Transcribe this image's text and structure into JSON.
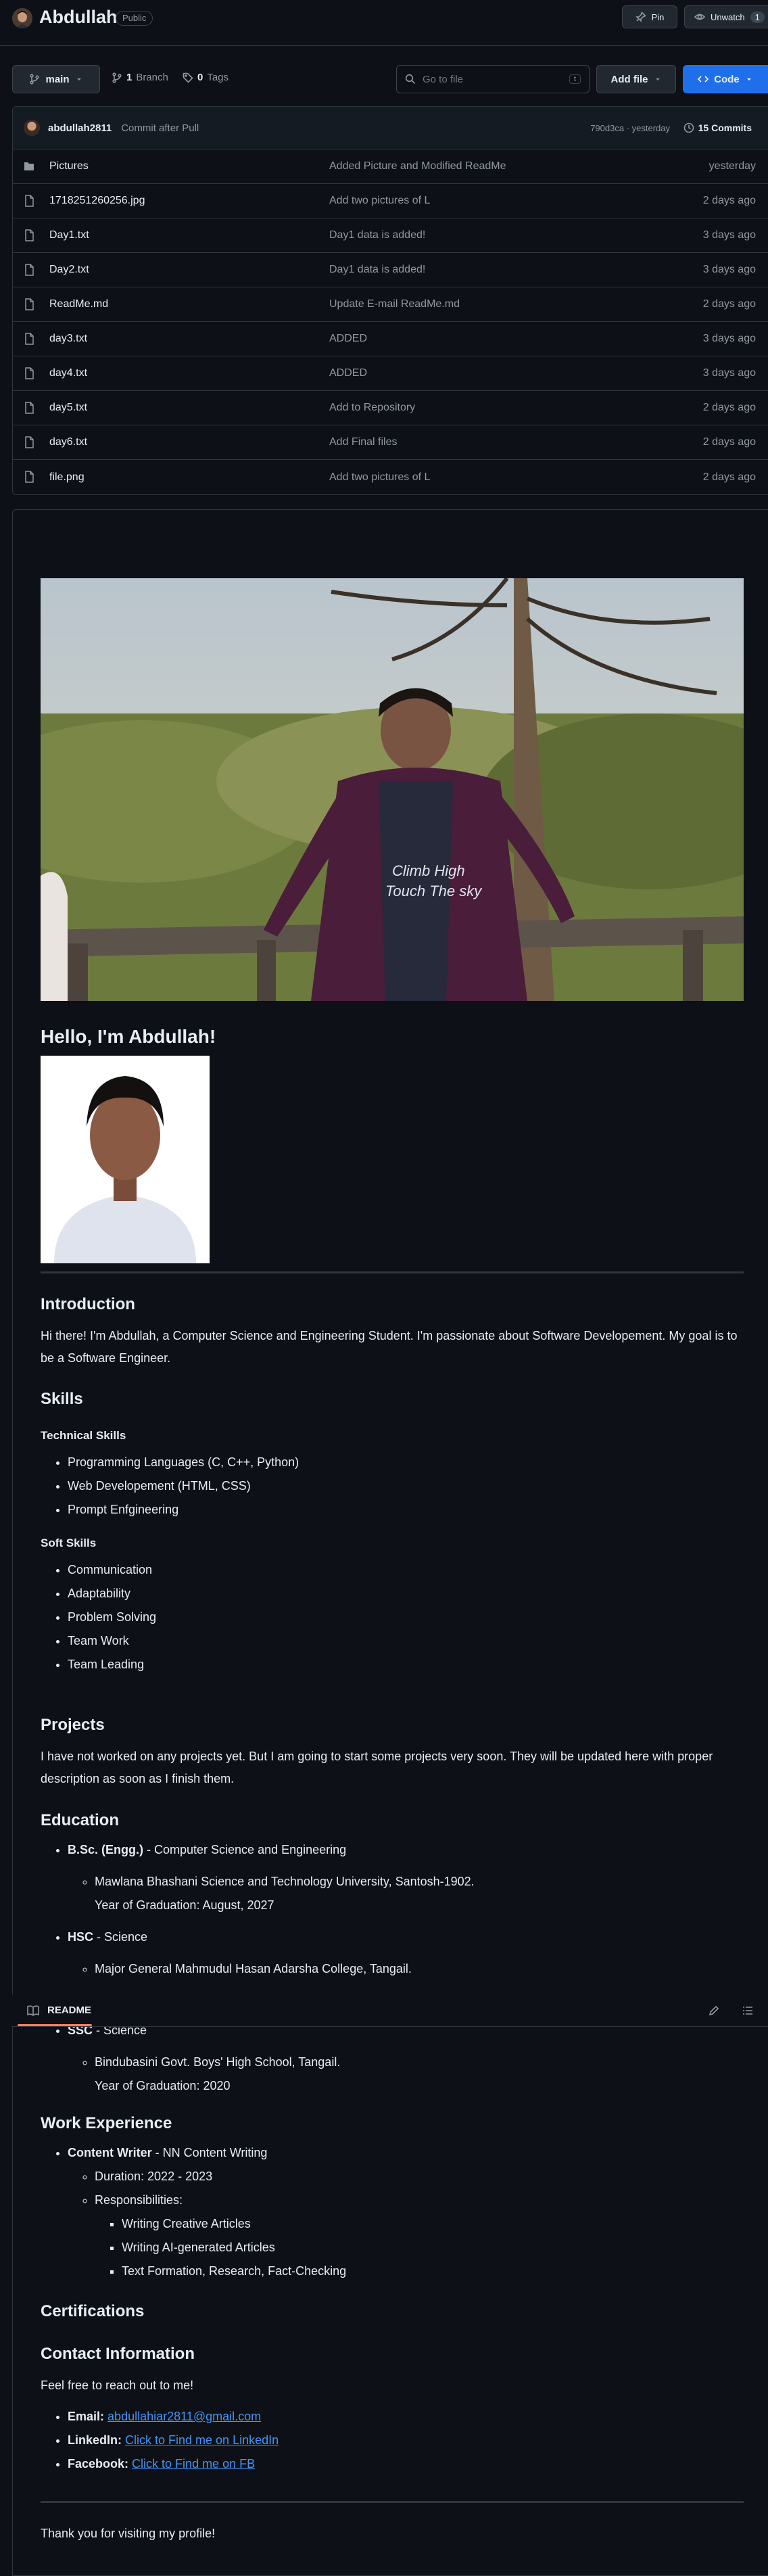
{
  "header": {
    "repo_name": "Abdullah",
    "visibility": "Public",
    "pin_label": "Pin",
    "unwatch_label": "Unwatch",
    "watch_count": "1"
  },
  "toolbar": {
    "branch": "main",
    "branches_count": "1",
    "branches_label": "Branch",
    "tags_count": "0",
    "tags_label": "Tags",
    "search_placeholder": "Go to file",
    "search_shortcut": "t",
    "add_file_label": "Add file",
    "code_label": "Code"
  },
  "commit": {
    "user": "abdullah2811",
    "message": "Commit after Pull",
    "sha_time": "790d3ca · yesterday",
    "commits_label": "15 Commits"
  },
  "files": [
    {
      "name": "Pictures",
      "type": "folder",
      "message": "Added Picture and Modified ReadMe",
      "date": "yesterday"
    },
    {
      "name": "1718251260256.jpg",
      "type": "file",
      "message": "Add two pictures of L",
      "date": "2 days ago"
    },
    {
      "name": "Day1.txt",
      "type": "file",
      "message": "Day1 data is added!",
      "date": "3 days ago"
    },
    {
      "name": "Day2.txt",
      "type": "file",
      "message": "Day1 data is added!",
      "date": "3 days ago"
    },
    {
      "name": "ReadMe.md",
      "type": "file",
      "message": "Update E-mail ReadMe.md",
      "date": "2 days ago"
    },
    {
      "name": "day3.txt",
      "type": "file",
      "message": "ADDED",
      "date": "3 days ago"
    },
    {
      "name": "day4.txt",
      "type": "file",
      "message": "ADDED",
      "date": "3 days ago"
    },
    {
      "name": "day5.txt",
      "type": "file",
      "message": "Add to Repository",
      "date": "2 days ago"
    },
    {
      "name": "day6.txt",
      "type": "file",
      "message": "Add Final files",
      "date": "2 days ago"
    },
    {
      "name": "file.png",
      "type": "file",
      "message": "Add two pictures of L",
      "date": "2 days ago"
    }
  ],
  "readme": {
    "tab_label": "README",
    "shirt_text_1": "Climb High",
    "shirt_text_2": "Touch The sky",
    "greeting": "Hello, I'm Abdullah!",
    "intro_heading": "Introduction",
    "intro_text": "Hi there! I'm Abdullah, a Computer Science and Engineering Student. I'm passionate about Software Developement. My goal is to be a Software Engineer.",
    "skills_heading": "Skills",
    "technical_heading": "Technical Skills",
    "technical_skills": [
      "Programming Languages (C, C++, Python)",
      "Web Developement (HTML, CSS)",
      "Prompt Enfgineering"
    ],
    "soft_heading": "Soft Skills",
    "soft_skills": [
      "Communication",
      "Adaptability",
      "Problem Solving",
      "Team Work",
      "Team Leading"
    ],
    "projects_heading": "Projects",
    "projects_text": "I have not worked on any projects yet. But I am going to start some projects very soon. They will be updated here with proper description as soon as I finish them.",
    "education_heading": "Education",
    "bsc_degree": "B.Sc. (Engg.)",
    "bsc_field": " - Computer Science and Engineering",
    "bsc_school": "Mawlana Bhashani Science and Technology University, Santosh-1902.",
    "bsc_year": "Year of Graduation: August, 2027",
    "hsc_degree": "HSC",
    "hsc_field": " - Science",
    "hsc_school": "Major General Mahmudul Hasan Adarsha College, Tangail.",
    "ssc_degree": "SSC",
    "ssc_field": " - Science",
    "ssc_school": "Bindubasini Govt. Boys' High School, Tangail.",
    "ssc_year": "Year of Graduation: 2020",
    "work_heading": "Work Experience",
    "work_title": "Content Writer",
    "work_company": " - NN Content Writing",
    "work_duration": "Duration: 2022 - 2023",
    "work_resp_label": "Responsibilities:",
    "work_resps": [
      "Writing Creative Articles",
      "Writing AI-generated Articles",
      "Text Formation, Research, Fact-Checking"
    ],
    "certs_heading": "Certifications",
    "contact_heading": "Contact Information",
    "contact_text": "Feel free to reach out to me!",
    "email_label": "Email:",
    "email_value": "abdullahiar2811@gmail.com",
    "linkedin_label": "LinkedIn:",
    "linkedin_value": "Click to Find me on LinkedIn",
    "facebook_label": "Facebook:",
    "facebook_value": "Click to Find me on FB",
    "thanks": "Thank you for visiting my profile!"
  }
}
